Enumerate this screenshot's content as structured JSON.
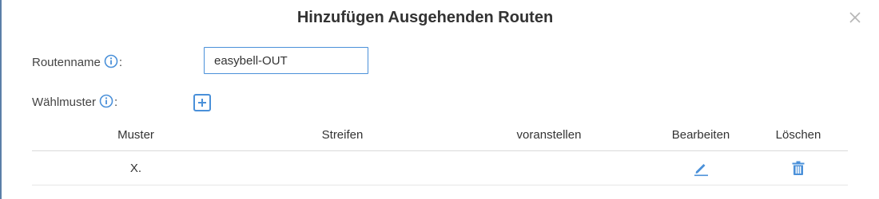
{
  "dialog": {
    "title": "Hinzufügen Ausgehenden Routen"
  },
  "form": {
    "route_name_label": "Routenname",
    "route_name_colon": ":",
    "route_name_value": "easybell-OUT",
    "dial_pattern_label": "Wählmuster",
    "dial_pattern_colon": ":"
  },
  "table": {
    "headers": {
      "muster": "Muster",
      "streifen": "Streifen",
      "voranstellen": "voranstellen",
      "bearbeiten": "Bearbeiten",
      "loeschen": "Löschen"
    },
    "rows": [
      {
        "muster": "X.",
        "streifen": "",
        "voranstellen": ""
      }
    ]
  },
  "icons": {
    "close": "close-icon",
    "info": "info-icon",
    "add": "plus-icon",
    "edit": "pencil-icon",
    "delete": "trash-icon"
  },
  "colors": {
    "accent": "#4a90d9",
    "title": "#333333",
    "divider": "#d9d9d9"
  }
}
